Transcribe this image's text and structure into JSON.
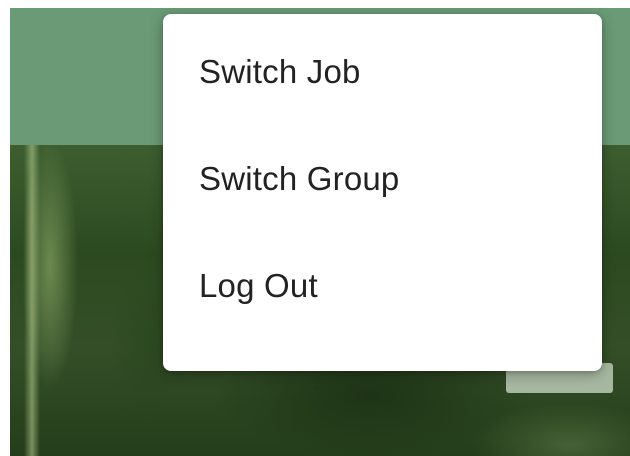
{
  "menu": {
    "items": [
      {
        "label": "Switch Job"
      },
      {
        "label": "Switch Group"
      },
      {
        "label": "Log Out"
      }
    ]
  },
  "colors": {
    "app_bar": "#6a9a76",
    "menu_background": "#ffffff",
    "menu_text": "#222222"
  }
}
